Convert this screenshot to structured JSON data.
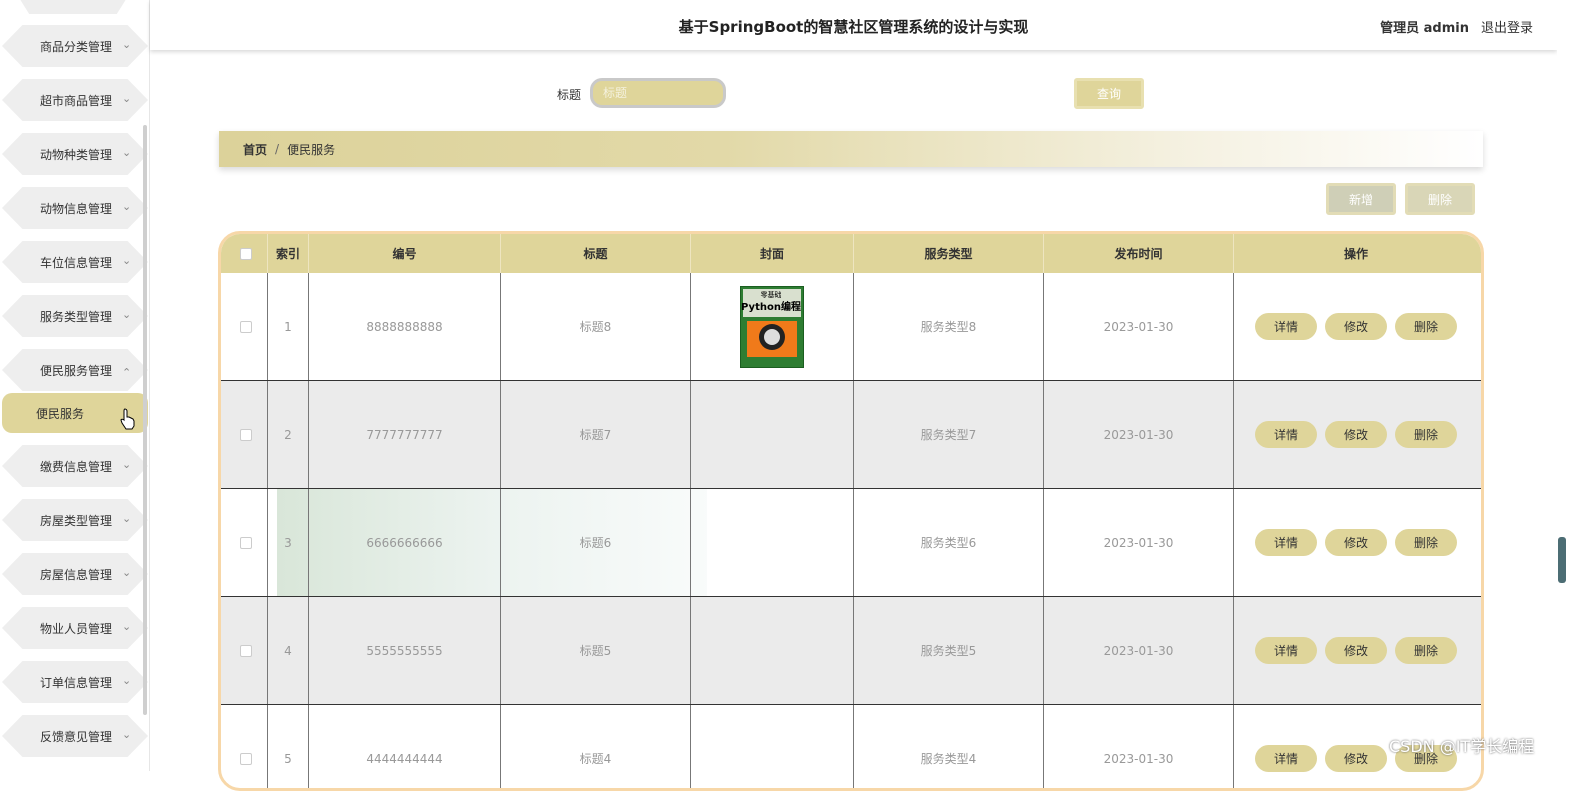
{
  "header": {
    "title": "基于SpringBoot的智慧社区管理系统的设计与实现",
    "user": "管理员 admin",
    "logout": "退出登录"
  },
  "sidebar": {
    "items": [
      {
        "label": "商品分类管理"
      },
      {
        "label": "超市商品管理"
      },
      {
        "label": "动物种类管理"
      },
      {
        "label": "动物信息管理"
      },
      {
        "label": "车位信息管理"
      },
      {
        "label": "服务类型管理"
      },
      {
        "label": "便民服务管理",
        "expanded": true
      },
      {
        "label": "缴费信息管理"
      },
      {
        "label": "房屋类型管理"
      },
      {
        "label": "房屋信息管理"
      },
      {
        "label": "物业人员管理"
      },
      {
        "label": "订单信息管理"
      },
      {
        "label": "反馈意见管理"
      }
    ],
    "sub_item": "便民服务"
  },
  "search": {
    "label": "标题",
    "placeholder": "标题",
    "button": "查询"
  },
  "breadcrumb": {
    "home": "首页",
    "separator": "/",
    "current": "便民服务"
  },
  "actions": {
    "add": "新增",
    "delete": "删除"
  },
  "table": {
    "columns": [
      "索引",
      "编号",
      "标题",
      "封面",
      "服务类型",
      "发布时间",
      "操作"
    ],
    "rows": [
      {
        "index": "1",
        "code": "8888888888",
        "title": "标题8",
        "has_cover": true,
        "type": "服务类型8",
        "date": "2023-01-30"
      },
      {
        "index": "2",
        "code": "7777777777",
        "title": "标题7",
        "has_cover": false,
        "type": "服务类型7",
        "date": "2023-01-30"
      },
      {
        "index": "3",
        "code": "6666666666",
        "title": "标题6",
        "has_cover": false,
        "type": "服务类型6",
        "date": "2023-01-30"
      },
      {
        "index": "4",
        "code": "5555555555",
        "title": "标题5",
        "has_cover": false,
        "type": "服务类型5",
        "date": "2023-01-30"
      },
      {
        "index": "5",
        "code": "4444444444",
        "title": "标题4",
        "has_cover": false,
        "type": "服务类型4",
        "date": "2023-01-30"
      }
    ],
    "row_actions": {
      "detail": "详情",
      "edit": "修改",
      "delete": "删除"
    }
  },
  "cover_book": {
    "line1": "零基础",
    "line2": "Python编程"
  },
  "watermark": "CSDN @IT学长编程",
  "colors": {
    "accent": "#dfd59a",
    "frame": "#f7d7a8"
  }
}
